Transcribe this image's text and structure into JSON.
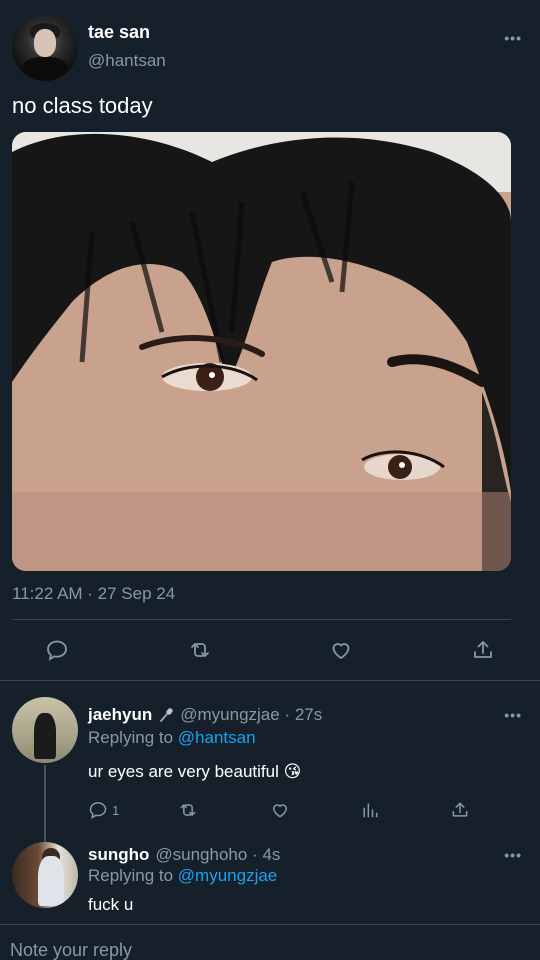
{
  "tweet": {
    "author_name": "tae san",
    "author_handle": "@hantsan",
    "text": "no class today",
    "timestamp": "11:22 AM · 27 Sep 24",
    "more_label": "•••"
  },
  "replies": [
    {
      "name": "jaehyun",
      "handle_time": "@myungzjae · 27s",
      "replying_prefix": "Replying to",
      "replying_to": "@hantsan",
      "text": "ur eyes are very beautiful",
      "emoji": "😘",
      "reply_count": "1"
    },
    {
      "name": "sungho",
      "handle_time": "@sunghoho · 4s",
      "replying_prefix": "Replying to",
      "replying_to": "@myungzjae",
      "text": "fuck u"
    }
  ],
  "compose": {
    "placeholder": "Note your reply"
  },
  "icons": {
    "reply": "comment-bubble-icon",
    "retweet": "retweet-icon",
    "like": "heart-icon",
    "share": "share-upload-icon",
    "analytics": "bar-chart-icon",
    "mic": "microphone-icon"
  },
  "colors": {
    "background": "#15202b",
    "secondary_text": "#8899a6",
    "link": "#1da1f2",
    "divider": "#38444d"
  }
}
